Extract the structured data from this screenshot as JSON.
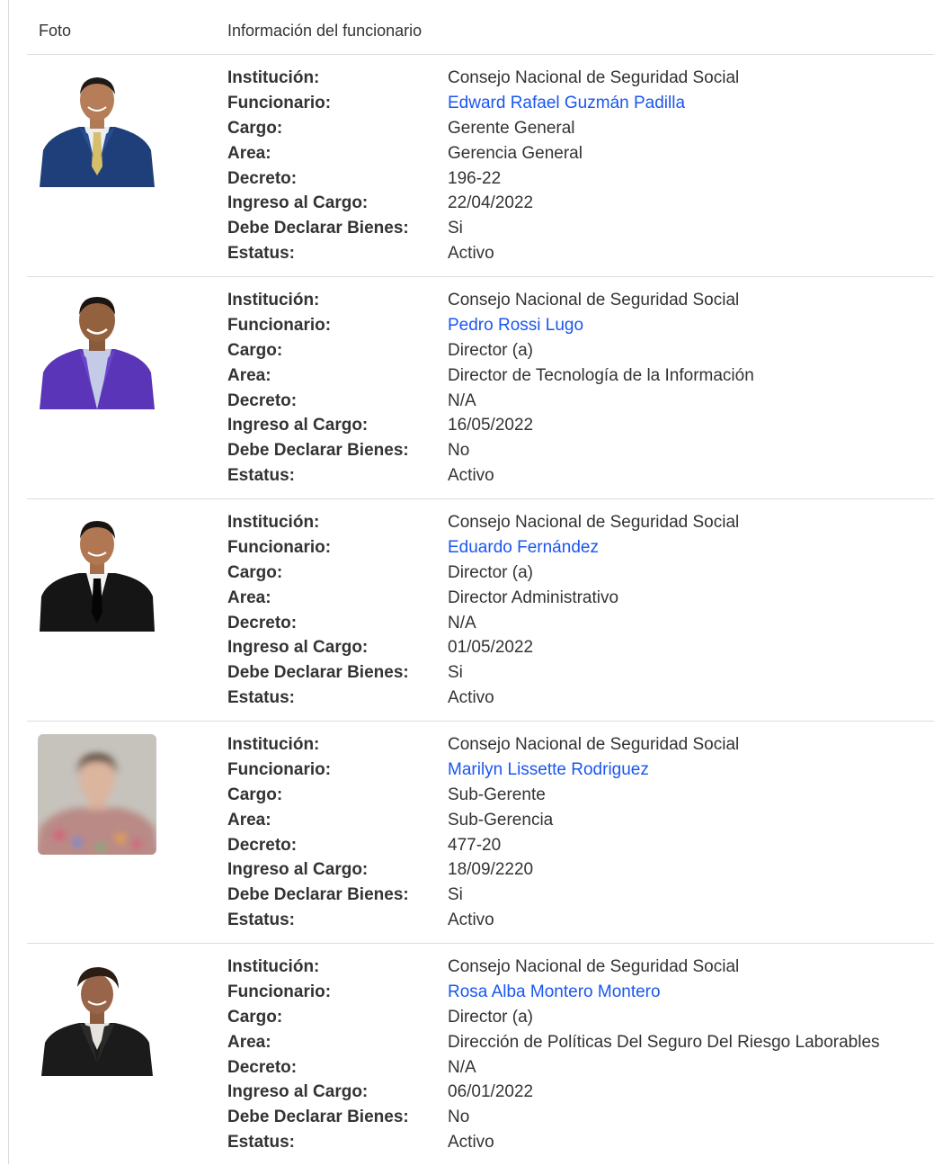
{
  "header": {
    "foto": "Foto",
    "info": "Información del funcionario"
  },
  "labels": {
    "institucion": "Institución:",
    "funcionario": "Funcionario:",
    "cargo": "Cargo:",
    "area": "Area:",
    "decreto": "Decreto:",
    "ingreso": "Ingreso al Cargo:",
    "declarar": "Debe Declarar Bienes:",
    "estatus": "Estatus:"
  },
  "colors": {
    "link": "#1a56f0",
    "text": "#333333",
    "divider": "#dddddd"
  },
  "officials": [
    {
      "photo": "man-blue-suit-photo",
      "institucion": "Consejo Nacional de Seguridad Social",
      "funcionario": "Edward Rafael Guzmán Padilla",
      "cargo": "Gerente General",
      "area": "Gerencia General",
      "decreto": "196-22",
      "ingreso": "22/04/2022",
      "declarar": "Si",
      "estatus": "Activo"
    },
    {
      "photo": "man-purple-suit-photo",
      "institucion": "Consejo Nacional de Seguridad Social",
      "funcionario": "Pedro Rossi Lugo",
      "cargo": "Director (a)",
      "area": "Director de Tecnología de la Información",
      "decreto": "N/A",
      "ingreso": "16/05/2022",
      "declarar": "No",
      "estatus": "Activo"
    },
    {
      "photo": "man-black-suit-photo",
      "institucion": "Consejo Nacional de Seguridad Social",
      "funcionario": "Eduardo Fernández",
      "cargo": "Director (a)",
      "area": "Director Administrativo",
      "decreto": "N/A",
      "ingreso": "01/05/2022",
      "declarar": "Si",
      "estatus": "Activo"
    },
    {
      "photo": "woman-blurred-photo",
      "institucion": "Consejo Nacional de Seguridad Social",
      "funcionario": "Marilyn Lissette Rodriguez",
      "cargo": "Sub-Gerente",
      "area": "Sub-Gerencia",
      "decreto": "477-20",
      "ingreso": "18/09/2220",
      "declarar": "Si",
      "estatus": "Activo"
    },
    {
      "photo": "woman-black-jacket-photo",
      "institucion": "Consejo Nacional de Seguridad Social",
      "funcionario": "Rosa Alba Montero Montero",
      "cargo": "Director (a)",
      "area": "Dirección de Políticas Del Seguro Del Riesgo Laborables",
      "decreto": "N/A",
      "ingreso": "06/01/2022",
      "declarar": "No",
      "estatus": "Activo"
    }
  ]
}
